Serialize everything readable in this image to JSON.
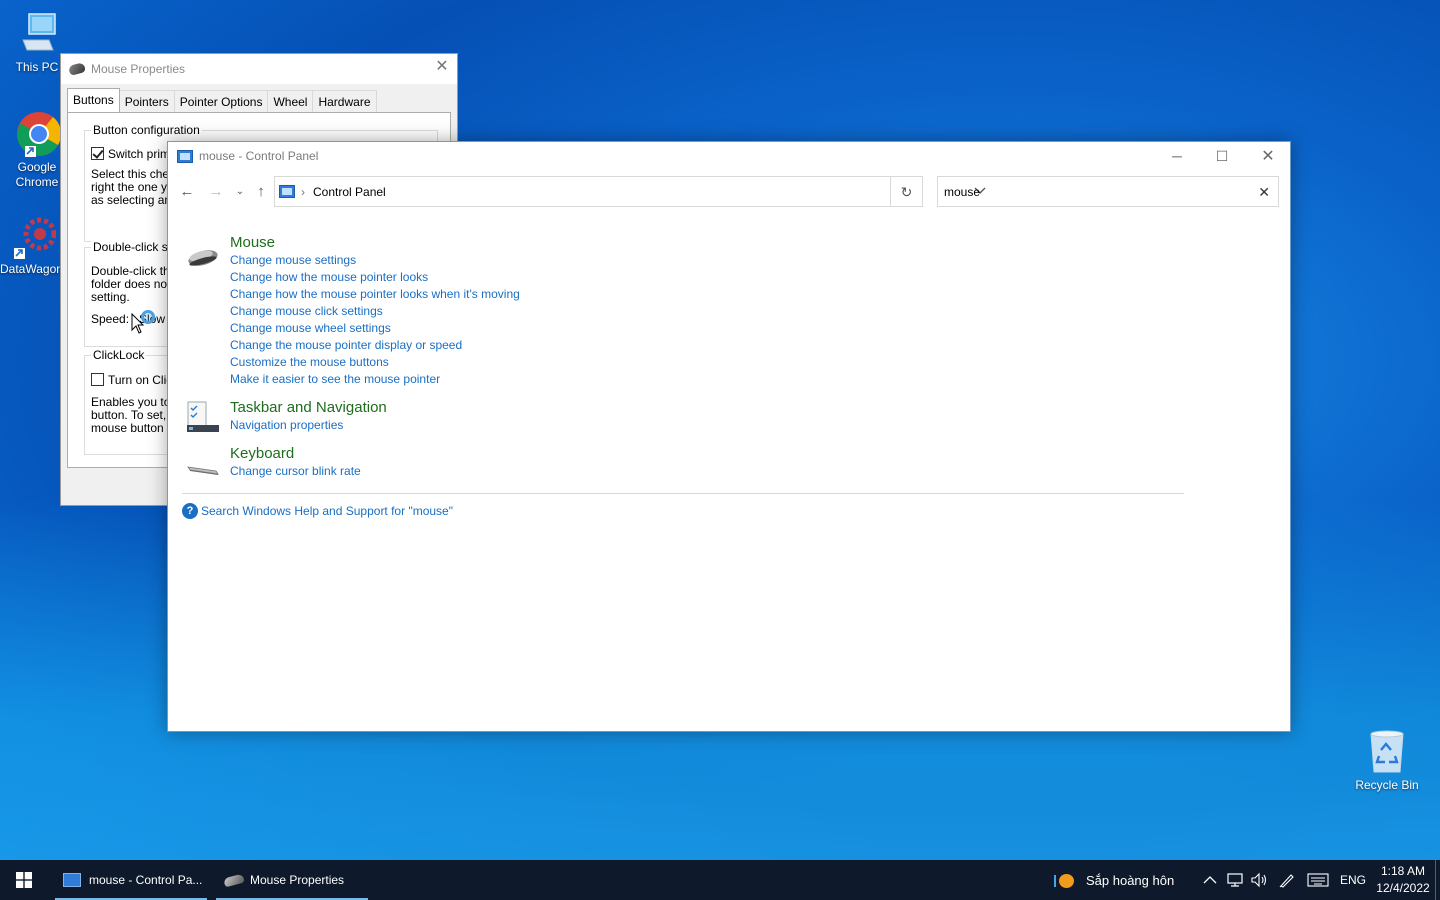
{
  "desktop": {
    "icons": [
      {
        "label": "This PC"
      },
      {
        "label": "Google Chrome"
      },
      {
        "label": "DataWagon"
      },
      {
        "label": "Recycle Bin"
      }
    ]
  },
  "mouse_props": {
    "title": "Mouse Properties",
    "tabs": [
      "Buttons",
      "Pointers",
      "Pointer Options",
      "Wheel",
      "Hardware"
    ],
    "active_tab": "Buttons",
    "button_config_label": "Button configuration",
    "switch_label": "Switch primar",
    "switch_checked": true,
    "switch_desc": [
      "Select this check",
      "right the one you",
      "as selecting and"
    ],
    "dblclick_label": "Double-click spe",
    "dblclick_desc": [
      "Double-click the",
      "folder does not o",
      "setting."
    ],
    "speed_label": "Speed:",
    "speed_value": "Slow",
    "clicklock_label": "ClickLock",
    "clicklock_check": "Turn on Click",
    "clicklock_checked": false,
    "clicklock_desc": [
      "Enables you to h",
      "button. To set, b",
      "mouse button ag"
    ]
  },
  "control_panel": {
    "title": "mouse - Control Panel",
    "breadcrumb": "Control Panel",
    "search_value": "mouse",
    "results": [
      {
        "title": "Mouse",
        "links": [
          "Change mouse settings",
          "Change how the mouse pointer looks",
          "Change how the mouse pointer looks when it's moving",
          "Change mouse click settings",
          "Change mouse wheel settings",
          "Change the mouse pointer display or speed",
          "Customize the mouse buttons",
          "Make it easier to see the mouse pointer"
        ]
      },
      {
        "title": "Taskbar and Navigation",
        "links": [
          "Navigation properties"
        ]
      },
      {
        "title": "Keyboard",
        "links": [
          "Change cursor blink rate"
        ]
      }
    ],
    "help_link": "Search Windows Help and Support for \"mouse\""
  },
  "taskbar": {
    "apps": [
      {
        "label": "mouse - Control Pa..."
      },
      {
        "label": "Mouse Properties"
      }
    ],
    "weather": "Sắp hoàng hôn",
    "language": "ENG",
    "time": "1:18 AM",
    "date": "12/4/2022"
  }
}
